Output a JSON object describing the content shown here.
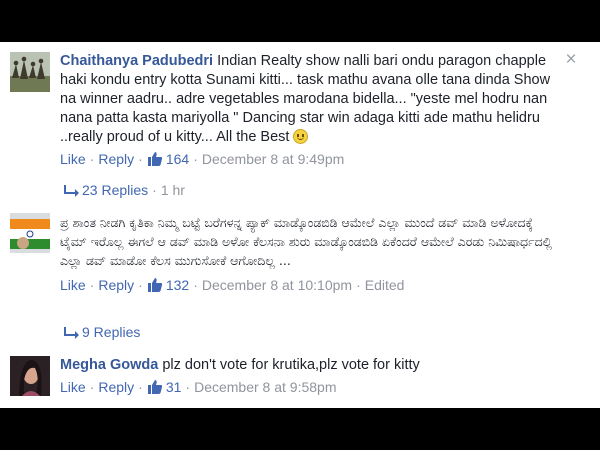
{
  "close_icon": "×",
  "comments": [
    {
      "author": "Chaithanya Padubedri",
      "text": "Indian Realty show nalli bari ondu paragon chapple haki kondu entry kotta Sunami kitti... task mathu avana olle tana dinda Show na winner aadru.. adre vegetables marodana bidella... \"yeste mel hodru nan nana patta kasta mariyolla \" Dancing star win adaga kitti ade mathu helidru ..really proud of u kitty... All the Best",
      "emoji": "smiley",
      "like": "Like",
      "reply": "Reply",
      "likes": "164",
      "time": "December 8 at 9:49pm",
      "replies": "23 Replies",
      "replies_time": "1 hr"
    },
    {
      "author": "",
      "text": "ಪ್ರ ಶಾಂತ ನೀಡಗಿ ಕೃತಿಕಾ ನಿಮ್ಮ ಬಟ್ಟೆ ಬರೆಗಳನ್ನ ಪ್ಯಾಕ್ ಮಾಡ್ಕೊಂಡಬಿಡಿ ಆಮೇಲೆ ಎಲ್ಲಾ ಮುಂದೆ ಡವ್ ಮಾಡಿ ಅಳೋದಕ್ಕೆ ಟೈಮ್ ಇರೊಲ್ಲ ಈಗಲೆ ಆ ಡವ್ ಮಾಡಿ ಅಳೋ ಕೆಲಸನಾ ಶುರು ಮಾಡ್ಕೊಂಡಬಿಡಿ ಏಕೆಂದರೆ ಆಮೇಲೆ ಎರಡು ನಿಮಿಷಾರ್ಧದಲ್ಲಿ ಎಲ್ಲಾ ಡವ್ ಮಾಡೋ ಕೆಲಸ ಮುಗುಸೋಕೆ ಆಗೋದಿಲ್ಲ ...",
      "like": "Like",
      "reply": "Reply",
      "likes": "132",
      "time": "December 8 at 10:10pm",
      "edited": "Edited",
      "replies": "9 Replies"
    },
    {
      "author": "Megha Gowda",
      "text": "plz don't vote for krutika,plz vote for kitty",
      "like": "Like",
      "reply": "Reply",
      "likes": "31",
      "time": "December 8 at 9:58pm"
    }
  ],
  "colors": {
    "link": "#365899",
    "action": "#4267b2",
    "meta": "#90949c",
    "text": "#1d2129"
  }
}
